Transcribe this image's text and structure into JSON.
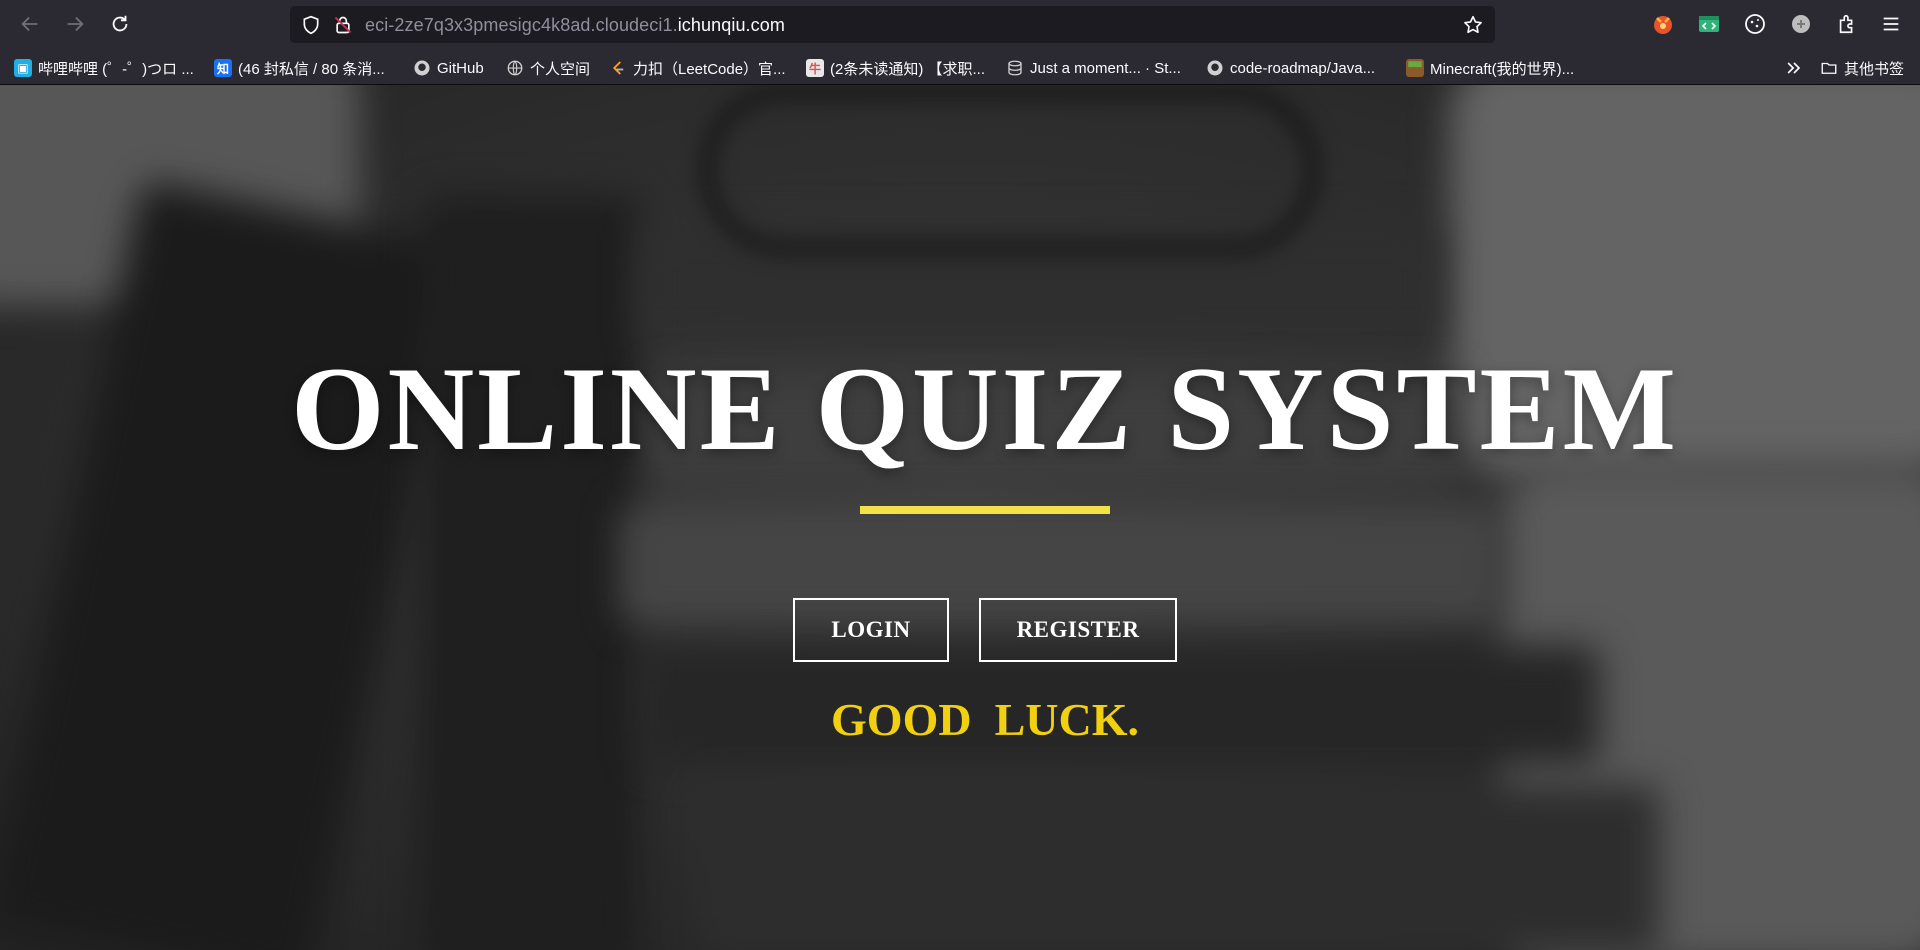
{
  "browser": {
    "url_prefix": "eci-2ze7q3x3pmesigc4k8ad.cloudeci1.",
    "url_domain": "ichunqiu.com",
    "bookmarks": [
      {
        "label": "哔哩哔哩 (゜-゜)つロ ...",
        "icon": "bilibili-icon",
        "color": "#23ade5"
      },
      {
        "label": "(46 封私信 / 80 条消...",
        "icon": "zhihu-icon",
        "color": "#1772f6"
      },
      {
        "label": "GitHub",
        "icon": "github-icon",
        "color": "#d0d0d0"
      },
      {
        "label": "个人空间",
        "icon": "globe-icon",
        "color": "#d0d0d0"
      },
      {
        "label": "力扣（LeetCode）官...",
        "icon": "leetcode-icon",
        "color": "#ffa116"
      },
      {
        "label": "(2条未读通知) 【求职...",
        "icon": "nowcoder-icon",
        "color": "#e0e0e0"
      },
      {
        "label": "Just a moment... · St...",
        "icon": "stack-icon",
        "color": "#d0d0d0"
      },
      {
        "label": "code-roadmap/Java...",
        "icon": "github-icon",
        "color": "#d0d0d0"
      },
      {
        "label": "Minecraft(我的世界)...",
        "icon": "minecraft-icon",
        "color": "#8a5a2b"
      }
    ],
    "other_bookmarks": "其他书签"
  },
  "hero": {
    "title": "ONLINE QUIZ SYSTEM",
    "login_label": "LOGIN",
    "register_label": "REGISTER",
    "tagline": "GOOD  LUCK."
  },
  "colors": {
    "accent_bar": "#f3e14a",
    "tagline": "#f1cf11"
  }
}
